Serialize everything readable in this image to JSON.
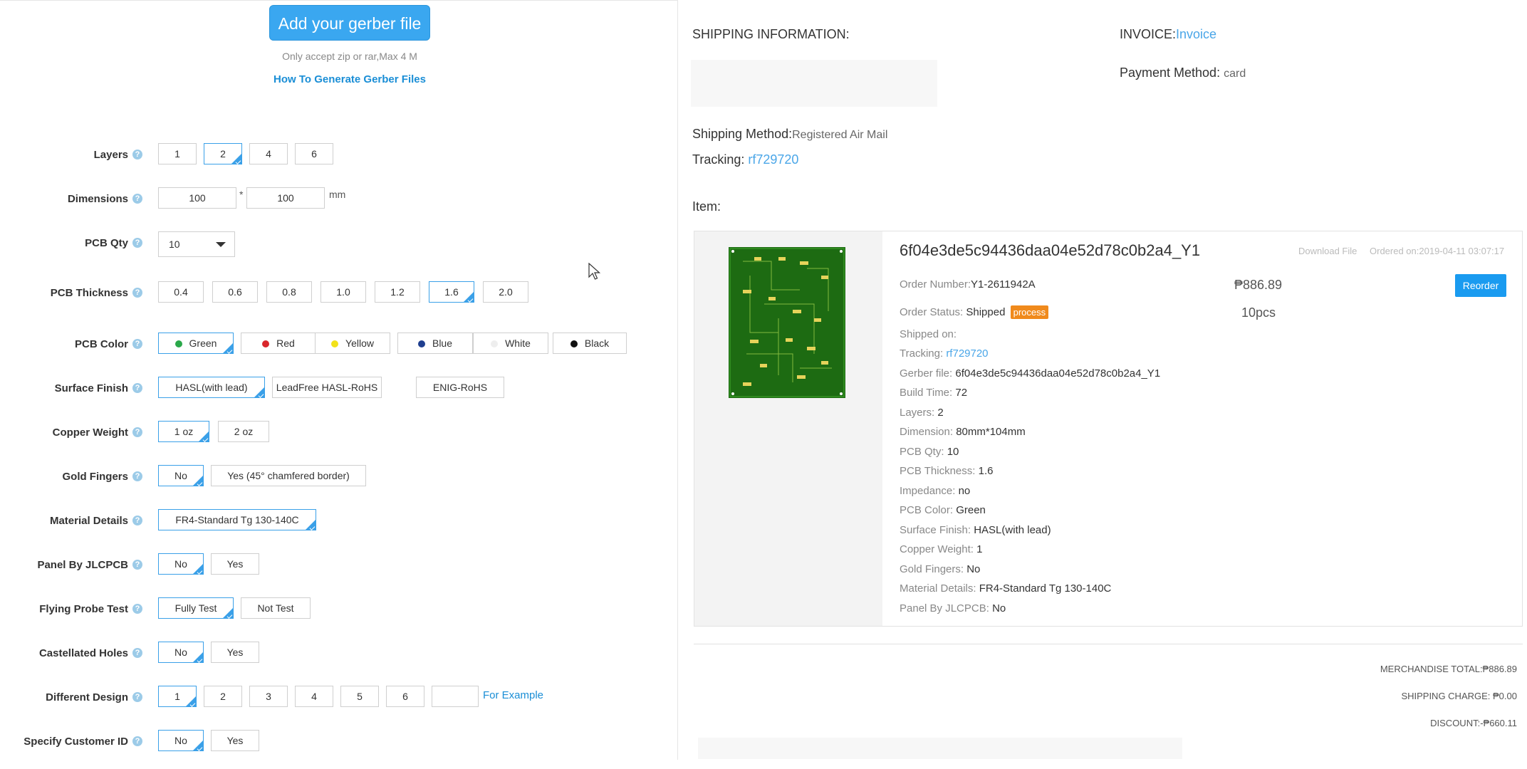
{
  "upload": {
    "button": "Add your gerber file",
    "note": "Only accept zip or rar,Max 4 M",
    "howto": "How To Generate Gerber Files"
  },
  "form": {
    "layers": {
      "label": "Layers",
      "options": [
        "1",
        "2",
        "4",
        "6"
      ]
    },
    "dimensions": {
      "label": "Dimensions",
      "width": "100",
      "height": "100",
      "sep": "*",
      "unit": "mm"
    },
    "qty": {
      "label": "PCB Qty",
      "value": "10"
    },
    "thickness": {
      "label": "PCB Thickness",
      "options": [
        "0.4",
        "0.6",
        "0.8",
        "1.0",
        "1.2",
        "1.6",
        "2.0"
      ]
    },
    "color": {
      "label": "PCB Color",
      "options": [
        "Green",
        "Red",
        "Yellow",
        "Blue",
        "White",
        "Black"
      ],
      "dots": [
        "#2aa84a",
        "#d9262b",
        "#f2e21a",
        "#1f3f8f",
        "#eeeeee",
        "#111111"
      ]
    },
    "surface": {
      "label": "Surface Finish",
      "options": [
        "HASL(with lead)",
        "LeadFree HASL-RoHS",
        "ENIG-RoHS"
      ]
    },
    "copper": {
      "label": "Copper Weight",
      "options": [
        "1 oz",
        "2 oz"
      ]
    },
    "gold": {
      "label": "Gold Fingers",
      "options": [
        "No",
        "Yes (45° chamfered border)"
      ]
    },
    "material": {
      "label": "Material Details",
      "options": [
        "FR4-Standard Tg 130-140C"
      ]
    },
    "panel": {
      "label": "Panel By JLCPCB",
      "options": [
        "No",
        "Yes"
      ]
    },
    "probe": {
      "label": "Flying Probe Test",
      "options": [
        "Fully Test",
        "Not Test"
      ]
    },
    "castellated": {
      "label": "Castellated Holes",
      "options": [
        "No",
        "Yes"
      ]
    },
    "design": {
      "label": "Different Design",
      "options": [
        "1",
        "2",
        "3",
        "4",
        "5",
        "6"
      ],
      "example": "For Example"
    },
    "customer": {
      "label": "Specify Customer ID",
      "options": [
        "No",
        "Yes"
      ]
    }
  },
  "order": {
    "shipping_info": "SHIPPING INFORMATION:",
    "invoice_label": "INVOICE:",
    "invoice_link": "Invoice",
    "payment_label": "Payment Method:",
    "payment_value": "card",
    "ship_method_label": "Shipping Method:",
    "ship_method_value": "Registered Air Mail",
    "tracking_label": "Tracking:",
    "tracking_value": "rf729720",
    "item_label": "Item:",
    "item": {
      "title": "6f04e3de5c94436daa04e52d78c0b2a4_Y1",
      "download": "Download File",
      "ordered_on": "Ordered on:2019-04-11 03:07:17",
      "price": "₱886.89",
      "qty": "10pcs",
      "reorder": "Reorder",
      "badge": "process",
      "details": [
        {
          "k": "Order Number:",
          "v": "Y1-2611942A"
        },
        {
          "k": "Order Status:",
          "v": "Shipped"
        },
        {
          "k": "Shipped on:",
          "v": ""
        },
        {
          "k": "Tracking:",
          "v": "rf729720"
        },
        {
          "k": "Gerber file:",
          "v": "6f04e3de5c94436daa04e52d78c0b2a4_Y1"
        },
        {
          "k": "Build Time:",
          "v": "72"
        },
        {
          "k": "Layers:",
          "v": "2"
        },
        {
          "k": "Dimension:",
          "v": "80mm*104mm"
        },
        {
          "k": "PCB Qty:",
          "v": "10"
        },
        {
          "k": "PCB Thickness:",
          "v": "1.6"
        },
        {
          "k": "Impedance:",
          "v": "no"
        },
        {
          "k": "PCB Color:",
          "v": "Green"
        },
        {
          "k": "Surface Finish:",
          "v": "HASL(with lead)"
        },
        {
          "k": "Copper Weight:",
          "v": "1"
        },
        {
          "k": "Gold Fingers:",
          "v": "No"
        },
        {
          "k": "Material Details:",
          "v": "FR4-Standard Tg 130-140C"
        },
        {
          "k": "Panel By JLCPCB:",
          "v": "No"
        }
      ]
    },
    "totals": {
      "merchandise": "MERCHANDISE TOTAL:₱886.89",
      "shipping": "SHIPPING CHARGE: ₱0.00",
      "discount": "DISCOUNT:-₱660.11"
    }
  }
}
